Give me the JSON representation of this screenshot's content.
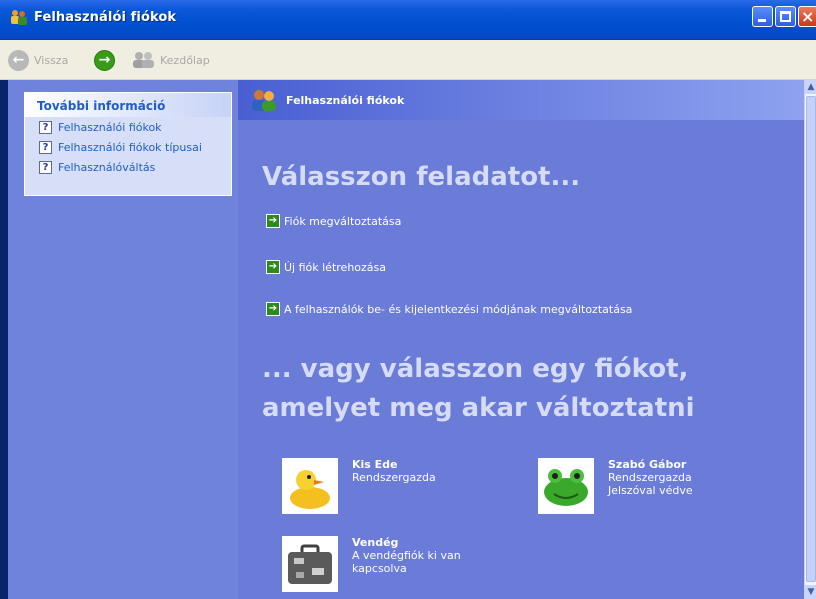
{
  "window": {
    "title": "Felhasználói fiókok",
    "buttons": {
      "minimize": "minimize",
      "maximize": "maximize",
      "close": "×"
    }
  },
  "toolbar": {
    "back_label": "Vissza",
    "home_label": "Kezdőlap"
  },
  "sidebar": {
    "header": "További információ",
    "links": [
      {
        "label": "Felhasználói fiókok",
        "icon": "help-icon"
      },
      {
        "label": "Felhasználói fiókok típusai",
        "icon": "help-icon"
      },
      {
        "label": "Felhasználóváltás",
        "icon": "help-icon"
      }
    ]
  },
  "main": {
    "header_title": "Felhasználói fiókok",
    "pick_task_heading": "Válasszon feladatot...",
    "tasks": [
      {
        "label": "Fiók megváltoztatása"
      },
      {
        "label": "Új fiók létrehozása"
      },
      {
        "label": "A felhasználók be- és kijelentkezési módjának megváltoztatása"
      }
    ],
    "pick_account_heading": "... vagy válasszon egy fiókot, amelyet meg akar változtatni",
    "accounts": [
      {
        "name": "Kis Ede",
        "line1": "Rendszergazda",
        "line2": "",
        "picture": "rubber-duck"
      },
      {
        "name": "Szabó Gábor",
        "line1": "Rendszergazda",
        "line2": "Jelszóval védve",
        "picture": "frog"
      },
      {
        "name": "Vendég",
        "line1": "A vendégfiók ki van",
        "line2": "kapcsolva",
        "picture": "suitcase"
      }
    ]
  },
  "colors": {
    "titlebar": "#0050d0",
    "left_pane": "#6f83dd",
    "main_pane": "#6a7cd8",
    "link": "#215dc6",
    "heading": "#d6dcf6"
  }
}
